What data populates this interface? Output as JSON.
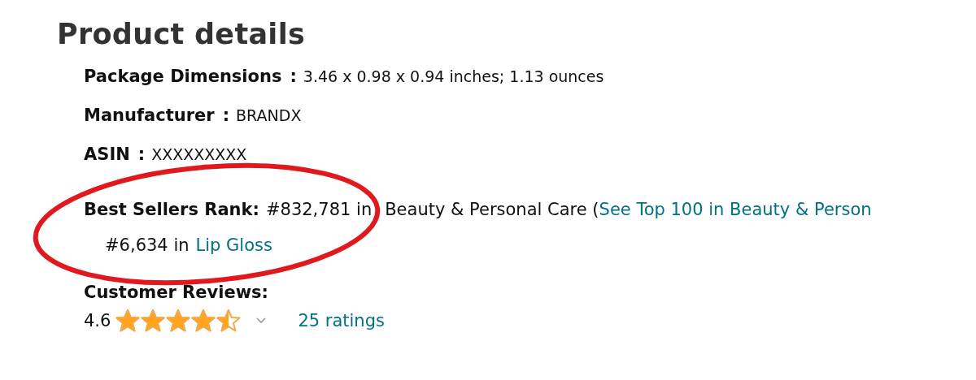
{
  "title": "Product details",
  "details": [
    {
      "label": "Package Dimensions",
      "separator": ":",
      "value": "3.46 x 0.98 x 0.94 inches; 1.13 ounces"
    },
    {
      "label": "Manufacturer",
      "separator": ":",
      "value": "BRANDX"
    },
    {
      "label": "ASIN",
      "separator": ":",
      "value": "XXXXXXXXX"
    }
  ],
  "best_sellers_rank": {
    "label": "Best Sellers Rank:",
    "rank": "#832,781 in",
    "category": "Beauty & Personal Care (",
    "link": "See Top 100 in Beauty & Person",
    "sub_rank": "#6,634 in",
    "sub_link": "Lip Gloss",
    "circled": true
  },
  "customer_reviews": {
    "label": "Customer Reviews:",
    "rating": "4.6",
    "stars": 4.5,
    "ratings_link": "25 ratings"
  }
}
